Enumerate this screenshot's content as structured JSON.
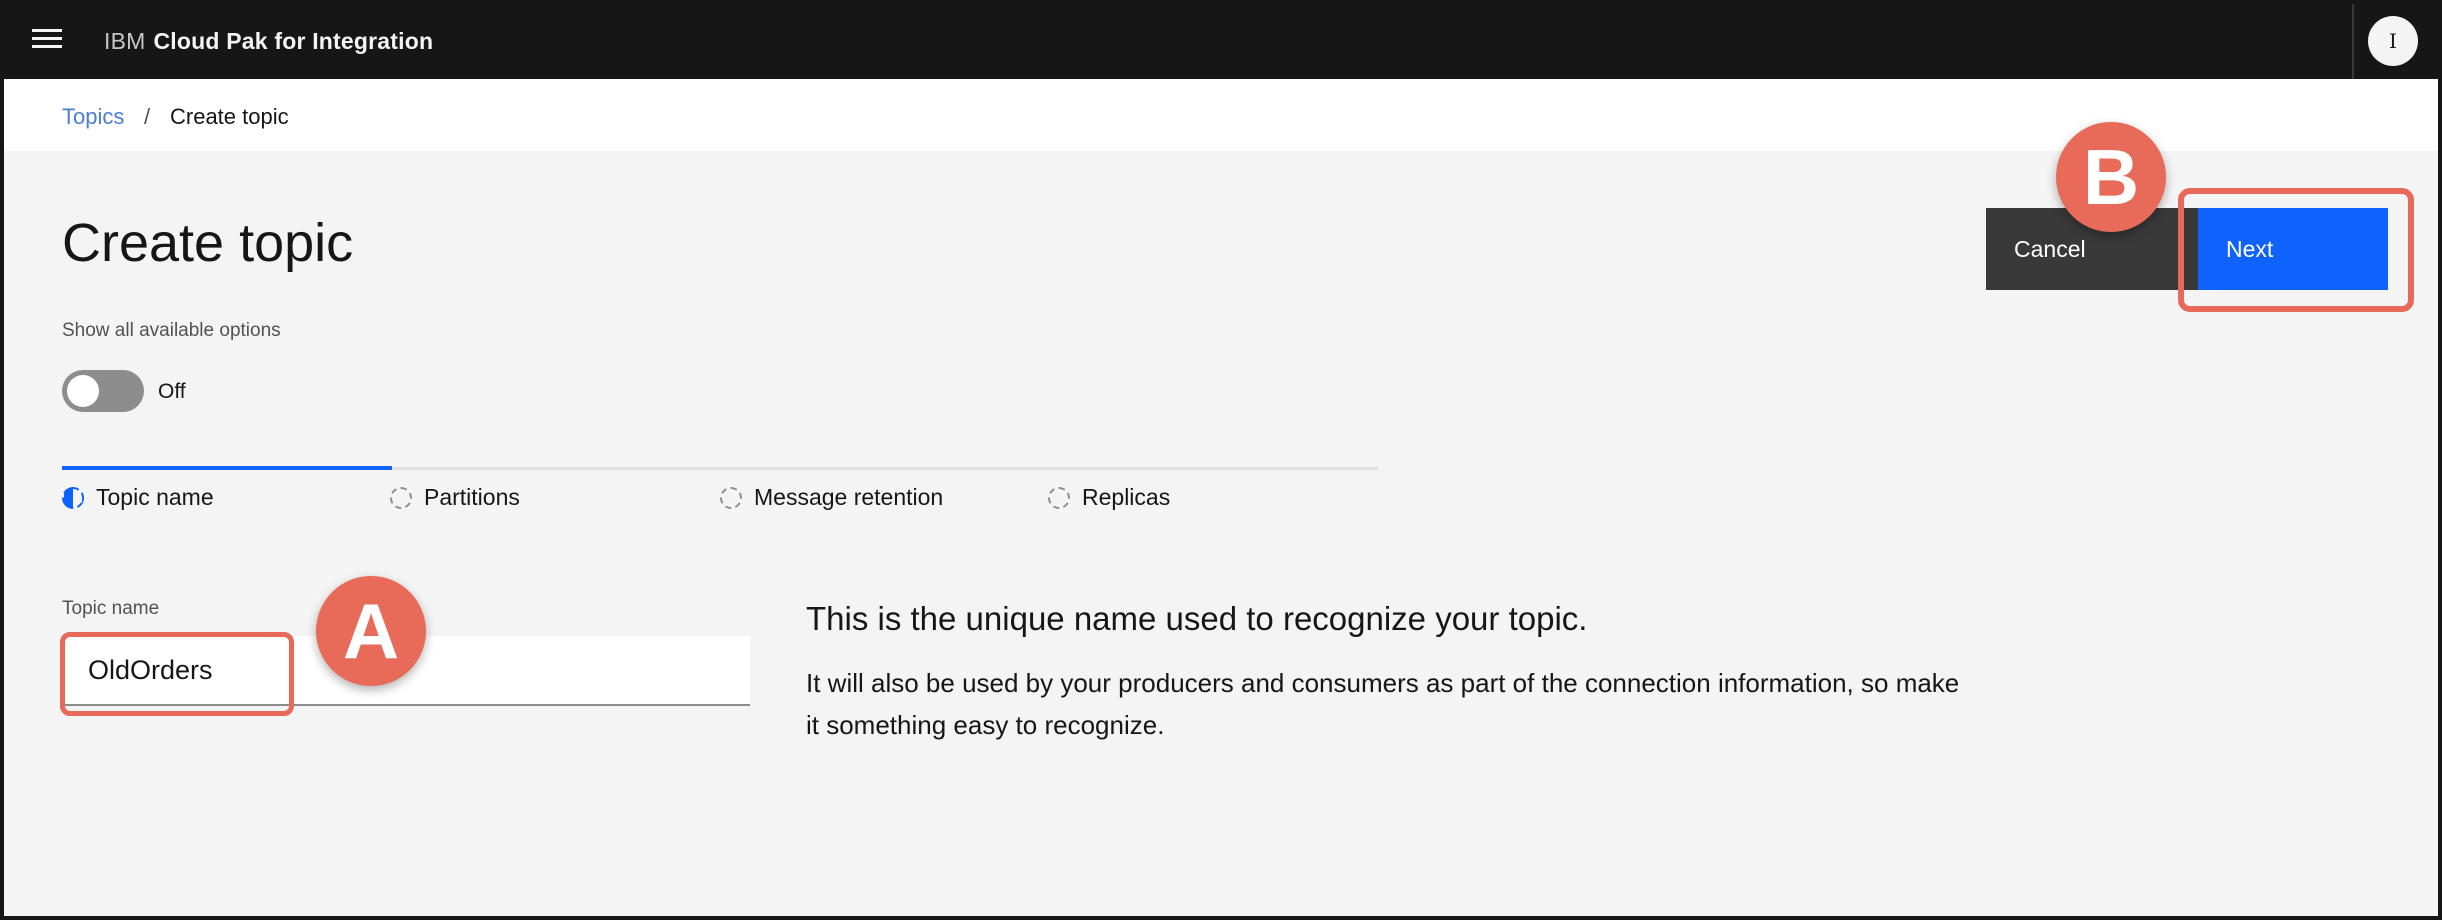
{
  "header": {
    "menu_icon": "hamburger-menu-icon",
    "brand_prefix": "IBM",
    "brand_product": "Cloud Pak for Integration",
    "user_initial": "I"
  },
  "breadcrumb": {
    "parent": "Topics",
    "separator": "/",
    "current": "Create topic"
  },
  "page": {
    "title": "Create topic",
    "options_toggle": {
      "label": "Show all available options",
      "state": "Off"
    }
  },
  "steps": [
    {
      "label": "Topic name",
      "status": "current"
    },
    {
      "label": "Partitions",
      "status": "incomplete"
    },
    {
      "label": "Message retention",
      "status": "incomplete"
    },
    {
      "label": "Replicas",
      "status": "incomplete"
    }
  ],
  "form": {
    "topic_name_label": "Topic name",
    "topic_name_value": "OldOrders"
  },
  "help": {
    "heading": "This is the unique name used to recognize your topic.",
    "body": "It will also be used by your producers and consumers as part of the connection information, so make it something easy to recognize."
  },
  "actions": {
    "cancel_label": "Cancel",
    "next_label": "Next"
  },
  "annotations": {
    "a_label": "A",
    "b_label": "B",
    "highlight_color": "#e8685a"
  },
  "colors": {
    "primary": "#0f62fe",
    "header_bg": "#161616",
    "link": "#4a7fd1"
  }
}
